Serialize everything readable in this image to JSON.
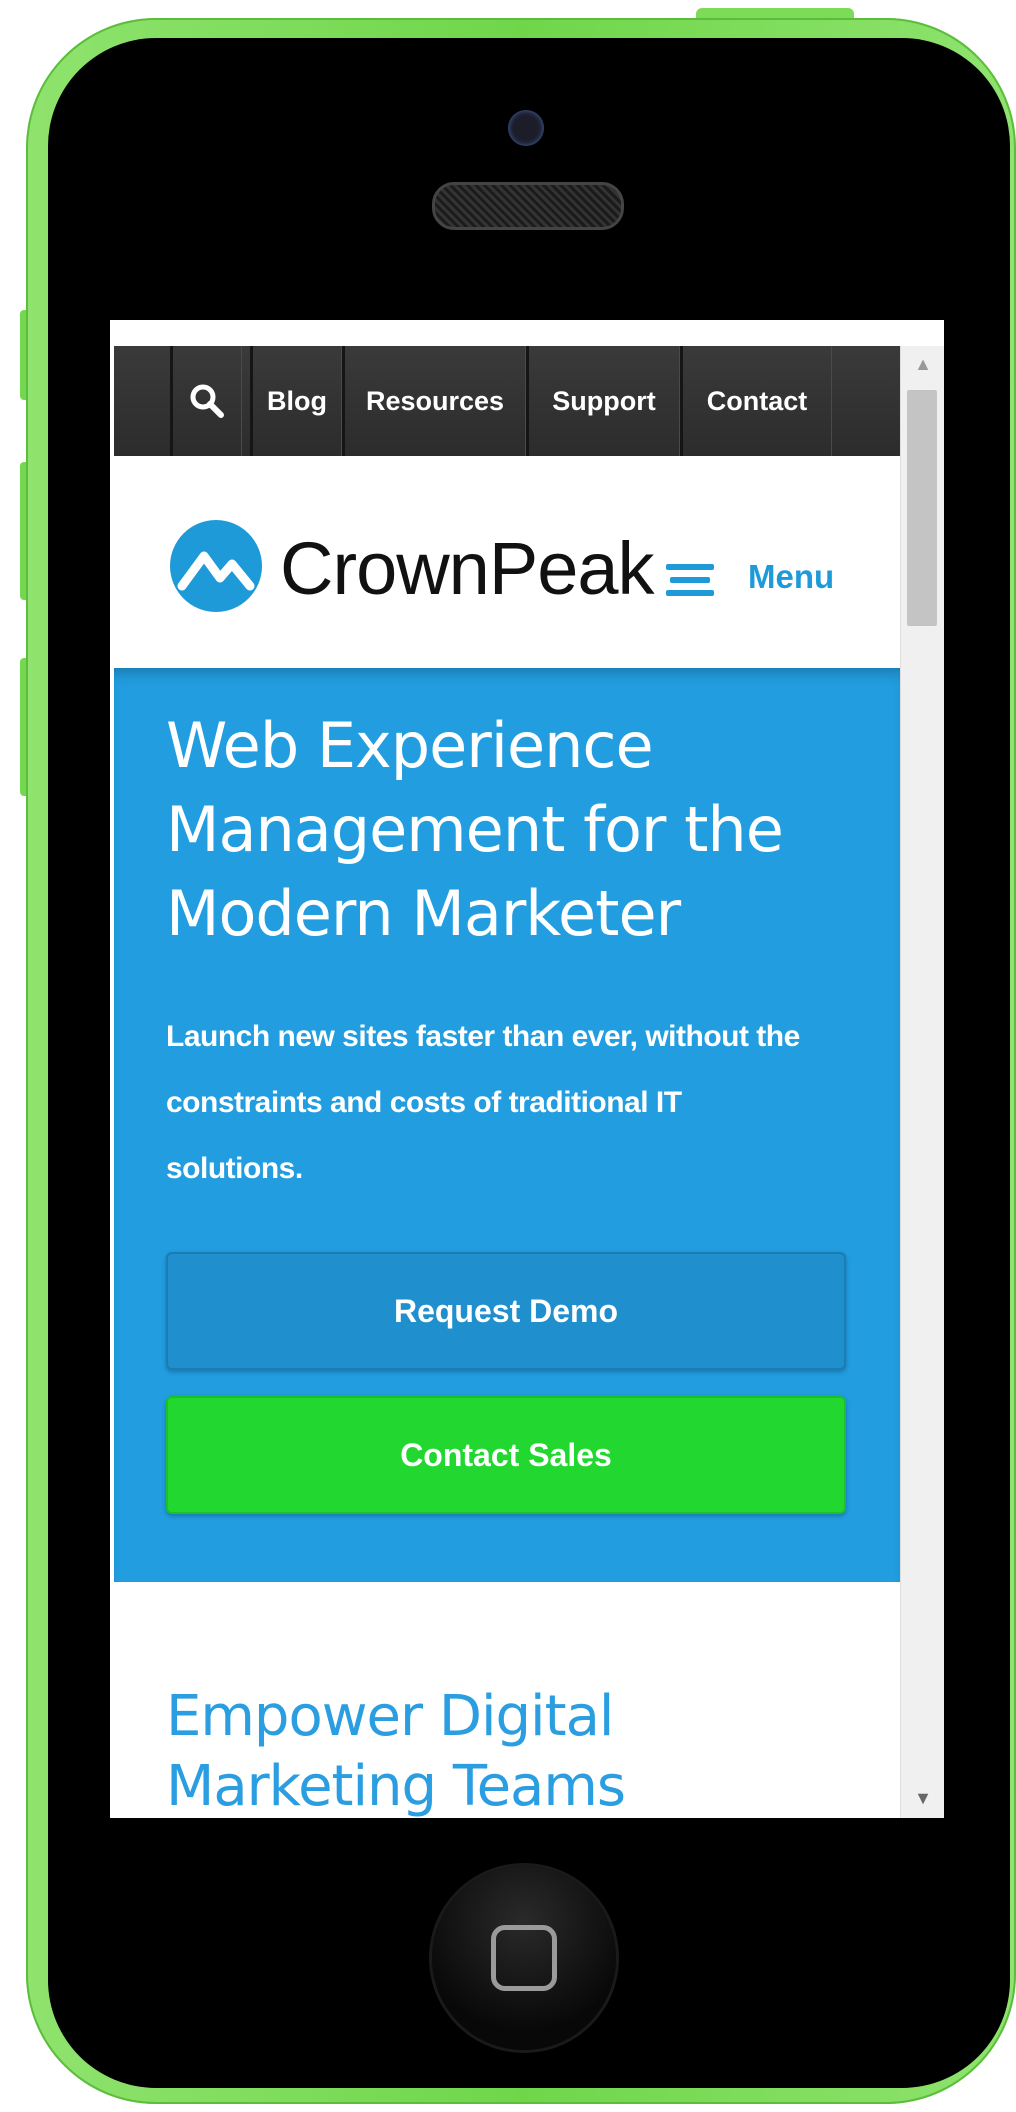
{
  "nav": {
    "search_icon": "search-icon",
    "items": [
      "Blog",
      "Resources",
      "Support",
      "Contact"
    ]
  },
  "header": {
    "logo_text": "CrownPeak",
    "menu_label": "Menu"
  },
  "hero": {
    "title": "Web Experience Management for the Modern Marketer",
    "subtitle": "Launch new sites faster than ever, without the constraints and costs of traditional IT solutions.",
    "request_demo": "Request Demo",
    "contact_sales": "Contact Sales"
  },
  "section": {
    "title": "Empower Digital Marketing Teams"
  },
  "colors": {
    "accent_blue": "#219de0",
    "cta_green": "#22d830",
    "phone_green": "#7cdc57"
  }
}
